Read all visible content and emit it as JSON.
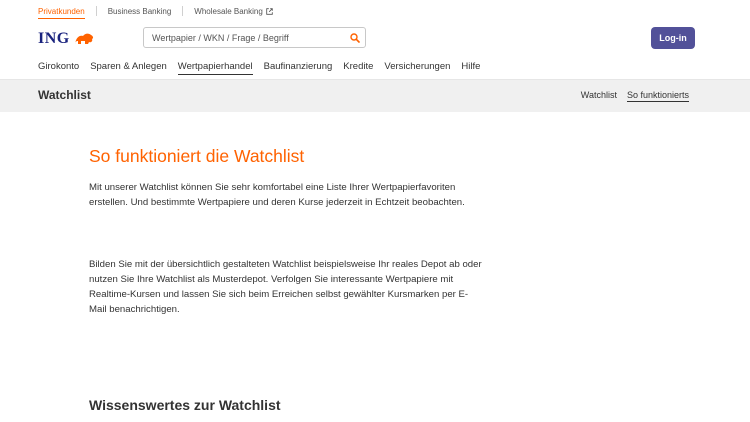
{
  "segments": [
    {
      "label": "Privatkunden",
      "active": true
    },
    {
      "label": "Business Banking",
      "active": false
    },
    {
      "label": "Wholesale Banking",
      "active": false,
      "external": true
    }
  ],
  "header": {
    "logo_text": "ING",
    "search_placeholder": "Wertpapier / WKN / Frage / Begriff",
    "login_label": "Log-in"
  },
  "nav": [
    {
      "label": "Girokonto"
    },
    {
      "label": "Sparen & Anlegen"
    },
    {
      "label": "Wertpapierhandel",
      "active": true
    },
    {
      "label": "Baufinanzierung"
    },
    {
      "label": "Kredite"
    },
    {
      "label": "Versicherungen"
    },
    {
      "label": "Hilfe"
    }
  ],
  "subnav": {
    "title": "Watchlist",
    "links": [
      {
        "label": "Watchlist"
      },
      {
        "label": "So funktionierts",
        "active": true
      }
    ]
  },
  "content": {
    "heading": "So funktioniert die Watchlist",
    "paragraph1": "Mit unserer Watchlist können Sie sehr komfortabel eine Liste Ihrer Wertpapierfavoriten erstellen. Und bestimmte Wertpapiere und deren Kurse jederzeit in Echtzeit beobachten.",
    "paragraph2": "Bilden Sie mit der übersichtlich gestalteten Watchlist beispielsweise Ihr reales Depot ab oder nutzen Sie Ihre Watchlist als Musterdepot. Verfolgen Sie interessante Wertpapiere mit Realtime-Kursen und lassen Sie sich beim Erreichen selbst gewählter Kursmarken per E-Mail benachrichtigen.",
    "subheading": "Wissenswertes zur Watchlist"
  },
  "colors": {
    "brand_orange": "#ff6200",
    "login_bg": "#525199",
    "logo_blue": "#1a237e"
  }
}
